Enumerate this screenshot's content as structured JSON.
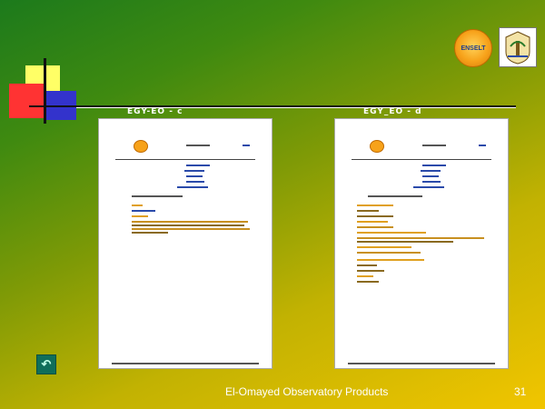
{
  "captions": {
    "left": "EGY-EO - c",
    "right": "EGY_EO - d"
  },
  "logos": {
    "left_text": "ENSELT"
  },
  "footer": {
    "text": "El-Omayed Observatory Products",
    "slide_number": "31"
  },
  "nav": {
    "icon": "return-icon"
  },
  "colors": {
    "background_top": "#1c7a1c",
    "background_bottom": "#f1c500",
    "accent": "#f7a21a"
  }
}
